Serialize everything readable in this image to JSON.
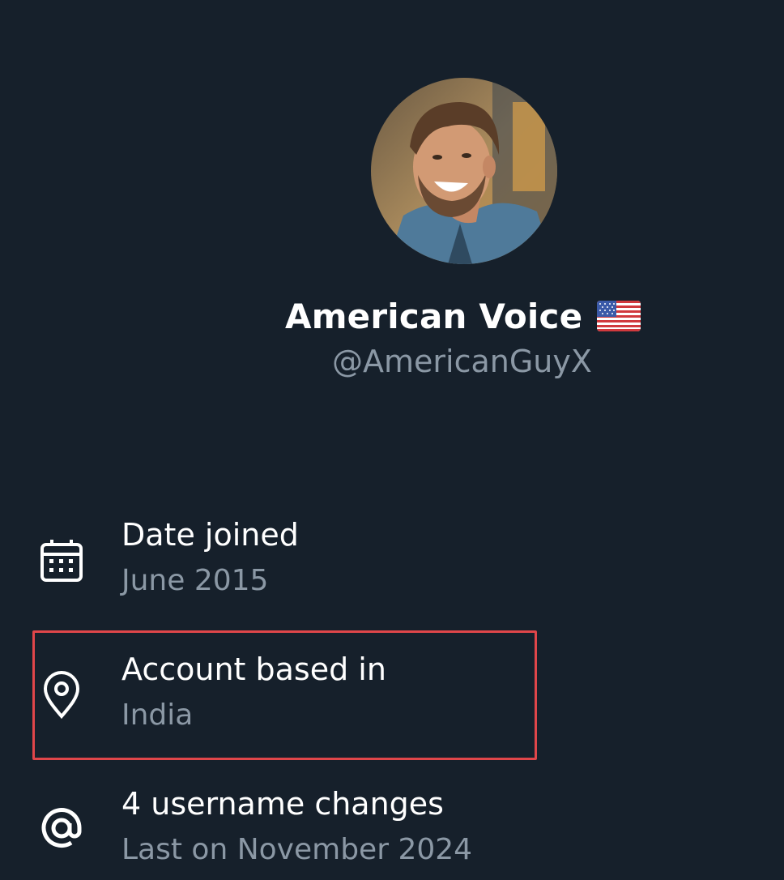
{
  "profile": {
    "display_name": "American Voice",
    "flag_emoji_name": "us-flag-icon",
    "handle": "@AmericanGuyX"
  },
  "info": {
    "date_joined": {
      "title": "Date joined",
      "value": "June 2015",
      "icon": "calendar-icon"
    },
    "location": {
      "title": "Account based in",
      "value": "India",
      "icon": "location-pin-icon"
    },
    "username_changes": {
      "title": "4 username changes",
      "value": "Last on November 2024",
      "icon": "at-sign-icon"
    }
  },
  "colors": {
    "background": "#16202b",
    "primary_text": "#ffffff",
    "secondary_text": "#8b98a5",
    "highlight_border": "#e0464a"
  }
}
